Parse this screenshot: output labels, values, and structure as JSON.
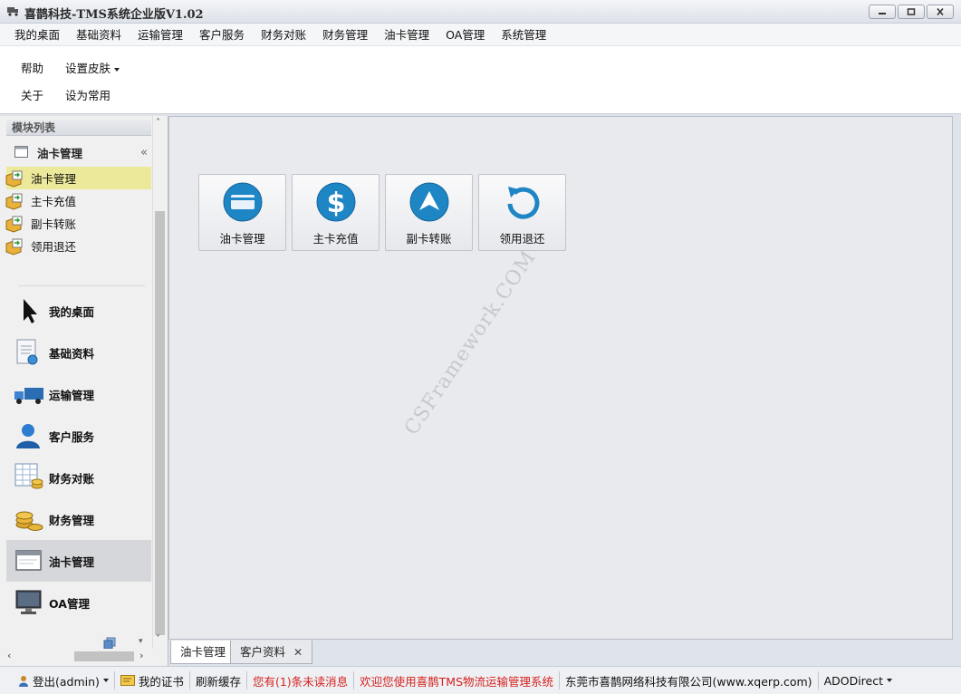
{
  "window": {
    "title": "喜鹊科技-TMS系统企业版V1.02"
  },
  "menu": [
    "我的桌面",
    "基础资料",
    "运输管理",
    "客户服务",
    "财务对账",
    "财务管理",
    "油卡管理",
    "OA管理",
    "系统管理"
  ],
  "ribbon": {
    "help": "帮助",
    "skin": "设置皮肤",
    "about": "关于",
    "favorite": "设为常用"
  },
  "sidebar": {
    "header": "模块列表",
    "group_title": "油卡管理",
    "sub_items": [
      "油卡管理",
      "主卡充值",
      "副卡转账",
      "领用退还"
    ],
    "modules": [
      {
        "label": "我的桌面",
        "icon": "cursor-icon"
      },
      {
        "label": "基础资料",
        "icon": "document-icon"
      },
      {
        "label": "运输管理",
        "icon": "truck-icon"
      },
      {
        "label": "客户服务",
        "icon": "user-icon"
      },
      {
        "label": "财务对账",
        "icon": "spreadsheet-coins-icon"
      },
      {
        "label": "财务管理",
        "icon": "coins-icon"
      },
      {
        "label": "油卡管理",
        "icon": "window-icon"
      },
      {
        "label": "OA管理",
        "icon": "monitor-icon"
      }
    ],
    "active_module": "油卡管理"
  },
  "tiles": [
    {
      "label": "油卡管理",
      "icon": "card-icon"
    },
    {
      "label": "主卡充值",
      "icon": "dollar-icon"
    },
    {
      "label": "副卡转账",
      "icon": "arrow-up-icon"
    },
    {
      "label": "领用退还",
      "icon": "return-icon"
    }
  ],
  "watermark": "CSFramework.COM",
  "tabs": [
    {
      "label": "油卡管理",
      "active": true
    },
    {
      "label": "客户资料",
      "active": false
    }
  ],
  "status": {
    "logout": "登出(admin)",
    "certificate": "我的证书",
    "refresh": "刷新缓存",
    "unread": "您有(1)条未读消息",
    "welcome": "欢迎您使用喜鹊TMS物流运输管理系统",
    "company": "东莞市喜鹊网络科技有限公司(www.xqerp.com)",
    "connection": "ADODirect"
  },
  "colors": {
    "accent_tile": "#1f86c5",
    "active_subitem": "#ece99a",
    "alert_text": "#d6211e"
  }
}
